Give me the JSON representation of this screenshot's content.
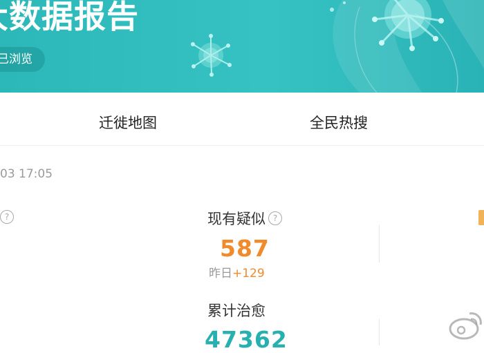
{
  "banner": {
    "title": "大数据报告",
    "views_text": "已浏览"
  },
  "tabs": [
    {
      "label": "迁徙地图"
    },
    {
      "label": "全民热搜"
    }
  ],
  "update_time": "03 17:05",
  "stats": {
    "suspected": {
      "label": "现有疑似",
      "value": "587",
      "delta_prefix": "昨日",
      "delta": "+129"
    },
    "cured": {
      "label": "累计治愈",
      "value": "47362"
    }
  },
  "icons": {
    "help": "question-circle-icon",
    "virus": "virus-icon",
    "weibo": "weibo-watermark-icon"
  },
  "colors": {
    "banner": "#36c2c2",
    "suspected": "#f08a2a",
    "cured": "#28b0b0"
  }
}
